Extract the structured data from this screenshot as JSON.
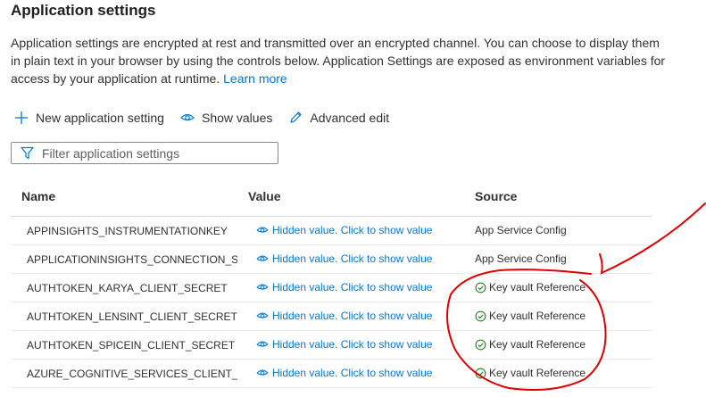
{
  "page": {
    "title": "Application settings",
    "description": "Application settings are encrypted at rest and transmitted over an encrypted channel. You can choose to display them in plain text in your browser by using the controls below. Application Settings are exposed as environment variables for access by your application at runtime.",
    "learn_more": "Learn more"
  },
  "toolbar": {
    "new_label": "New application setting",
    "show_label": "Show values",
    "edit_label": "Advanced edit"
  },
  "filter": {
    "placeholder": "Filter application settings"
  },
  "table": {
    "headers": {
      "name": "Name",
      "value": "Value",
      "source": "Source"
    },
    "rows": [
      {
        "name": "APPINSIGHTS_INSTRUMENTATIONKEY",
        "value": "Hidden value. Click to show value",
        "source": "App Service Config"
      },
      {
        "name": "APPLICATIONINSIGHTS_CONNECTION_STRING",
        "value": "Hidden value. Click to show value",
        "source": "App Service Config"
      },
      {
        "name": "AUTHTOKEN_KARYA_CLIENT_SECRET",
        "value": "Hidden value. Click to show value",
        "source": "Key vault Reference"
      },
      {
        "name": "AUTHTOKEN_LENSINT_CLIENT_SECRET",
        "value": "Hidden value. Click to show value",
        "source": "Key vault Reference"
      },
      {
        "name": "AUTHTOKEN_SPICEIN_CLIENT_SECRET",
        "value": "Hidden value. Click to show value",
        "source": "Key vault Reference"
      },
      {
        "name": "AZURE_COGNITIVE_SERVICES_CLIENT_SECRET",
        "value": "Hidden value. Click to show value",
        "source": "Key vault Reference"
      }
    ]
  },
  "icons": {
    "new": "plus-icon",
    "show": "eye-icon",
    "edit": "pencil-icon",
    "filter": "funnel-icon",
    "value": "eye-icon",
    "key_vault": "check-circle-icon"
  },
  "colors": {
    "link": "#0078d4",
    "check": "#107c10",
    "annotation": "#e00000"
  }
}
